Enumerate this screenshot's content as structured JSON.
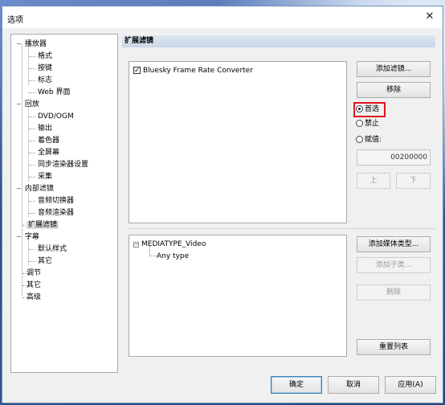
{
  "window": {
    "title": "选项",
    "close_glyph": "✕"
  },
  "tree": {
    "items": [
      {
        "label": "播放器"
      },
      {
        "label": "格式"
      },
      {
        "label": "按键"
      },
      {
        "label": "标志"
      },
      {
        "label": "Web 界面"
      },
      {
        "label": "回放"
      },
      {
        "label": "DVD/OGM"
      },
      {
        "label": "输出"
      },
      {
        "label": "着色器"
      },
      {
        "label": "全屏幕"
      },
      {
        "label": "同步渲染器设置"
      },
      {
        "label": "采集"
      },
      {
        "label": "内部滤镜"
      },
      {
        "label": "音频切换器"
      },
      {
        "label": "音频渲染器"
      },
      {
        "label": "扩展滤镜"
      },
      {
        "label": "字幕"
      },
      {
        "label": "默认样式"
      },
      {
        "label": "其它"
      },
      {
        "label": "调节"
      },
      {
        "label": "其它"
      },
      {
        "label": "高级"
      }
    ],
    "expander": "−",
    "selected_index": 15
  },
  "section": {
    "header": "扩展滤镜"
  },
  "filters": {
    "items": [
      {
        "label": "Bluesky Frame Rate Converter",
        "checked": true
      }
    ]
  },
  "filter_buttons": {
    "add_filter": "添加滤镜...",
    "remove": "移除",
    "up": "上",
    "down": "下"
  },
  "merit": {
    "prefer": "首选",
    "block": "禁止",
    "set_merit": "赋值:",
    "selected": "prefer",
    "value": "00200000"
  },
  "media_types": {
    "items": [
      {
        "label": "MEDIATYPE_Video",
        "children": [
          {
            "label": "Any type"
          }
        ]
      }
    ],
    "collapse_glyph": "−"
  },
  "media_buttons": {
    "add_media_type": "添加媒体类型...",
    "add_subtype": "添加子类...",
    "delete": "删除",
    "reset_list": "重置列表"
  },
  "dialog_buttons": {
    "ok": "确定",
    "cancel": "取消",
    "apply": "应用(A)"
  }
}
